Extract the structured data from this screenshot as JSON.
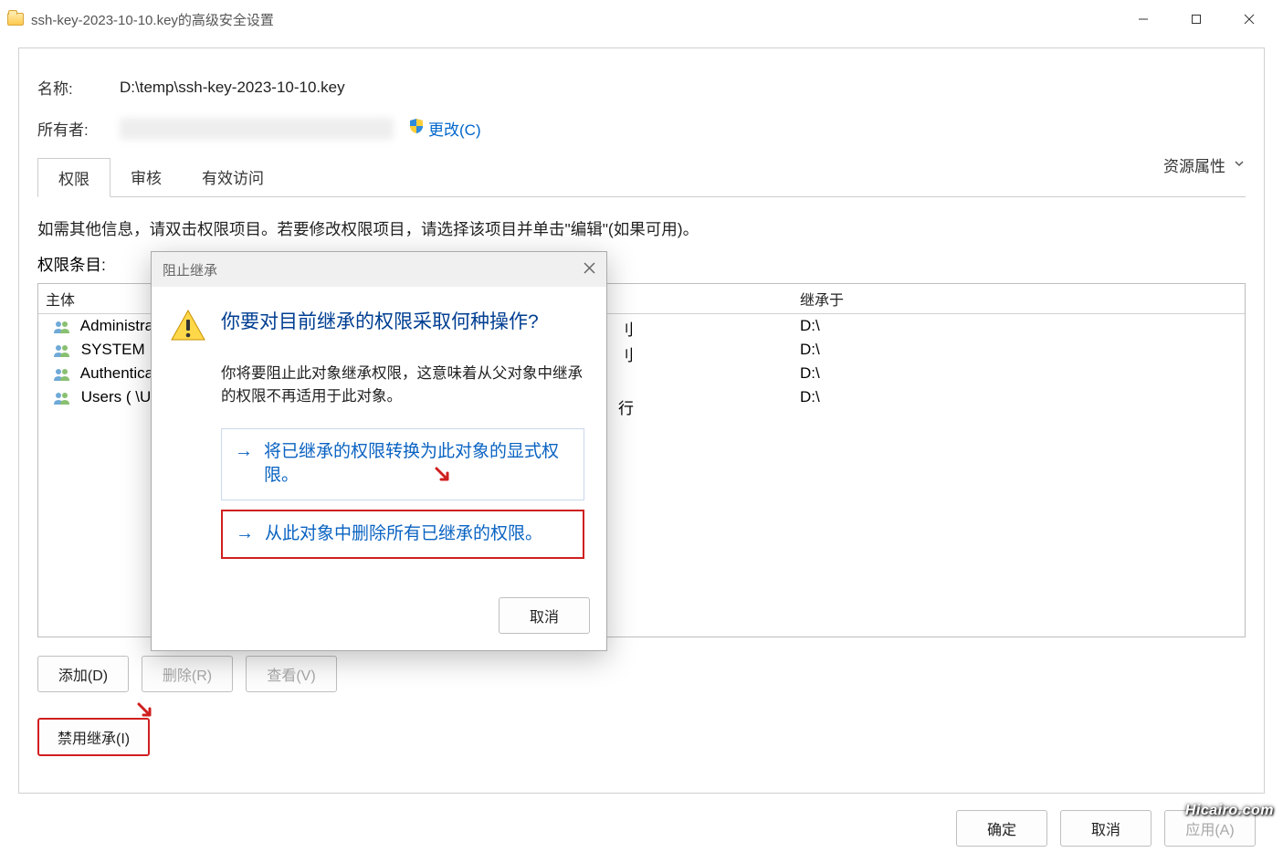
{
  "window": {
    "title": "ssh-key-2023-10-10.key的高级安全设置"
  },
  "fields": {
    "name_label": "名称:",
    "name_value": "D:\\temp\\ssh-key-2023-10-10.key",
    "owner_label": "所有者:",
    "change_link": "更改(C)",
    "resource_attr": "资源属性"
  },
  "tabs": {
    "perm": "权限",
    "audit": "审核",
    "effective": "有效访问"
  },
  "info_text": "如需其他信息，请双击权限项目。若要修改权限项目，请选择该项目并单击\"编辑\"(如果可用)。",
  "perm_title": "权限条目:",
  "table": {
    "col_principal": "主体",
    "col_inherit": "继承于",
    "rows": [
      {
        "principal": "Administrato",
        "inherit": "D:\\"
      },
      {
        "principal": "SYSTEM",
        "inherit": "D:\\"
      },
      {
        "principal": "Authenticate",
        "inherit": "D:\\"
      },
      {
        "principal": "Users (         \\U",
        "inherit": "D:\\"
      }
    ],
    "hidden_col_perm_value": "行"
  },
  "buttons": {
    "add": "添加(D)",
    "remove": "删除(R)",
    "view": "查看(V)",
    "disable_inherit": "禁用继承(I)",
    "ok": "确定",
    "cancel": "取消",
    "apply": "应用(A)"
  },
  "modal": {
    "title": "阻止继承",
    "question": "你要对目前继承的权限采取何种操作?",
    "desc": "你将要阻止此对象继承权限，这意味着从父对象中继承的权限不再适用于此对象。",
    "option1": "将已继承的权限转换为此对象的显式权限。",
    "option2": "从此对象中删除所有已继承的权限。",
    "cancel": "取消"
  },
  "watermark": "Hicairo.com"
}
